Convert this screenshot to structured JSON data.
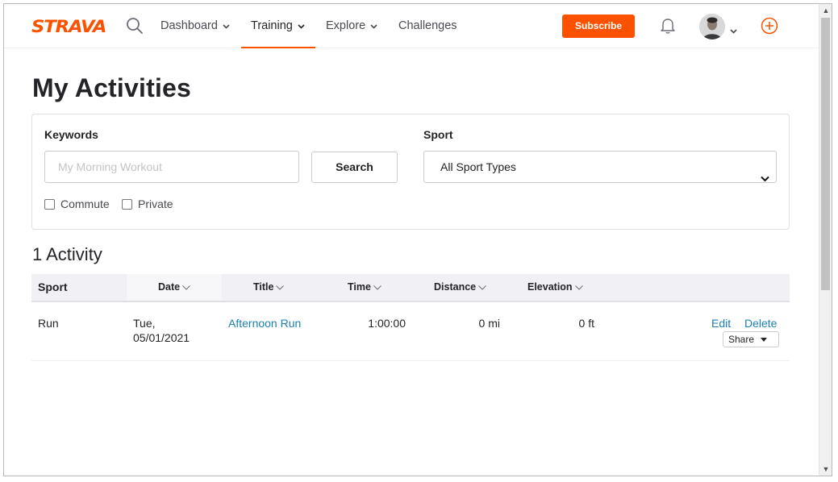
{
  "nav": {
    "logo": "STRAVA",
    "items": [
      {
        "label": "Dashboard",
        "has_menu": true
      },
      {
        "label": "Training",
        "has_menu": true,
        "active": true
      },
      {
        "label": "Explore",
        "has_menu": true
      },
      {
        "label": "Challenges",
        "has_menu": false
      }
    ],
    "subscribe_label": "Subscribe",
    "icons": {
      "search": "search-icon",
      "notifications": "bell-icon",
      "avatar": "avatar",
      "upload": "plus-circle-icon"
    }
  },
  "colors": {
    "brand": "#fc5200",
    "link": "#1c7fb0",
    "text": "#242428",
    "header_bg": "#f0f0f5"
  },
  "page": {
    "title": "My Activities"
  },
  "filters": {
    "keywords_label": "Keywords",
    "keywords_placeholder": "My Morning Workout",
    "keywords_value": "",
    "search_label": "Search",
    "sport_label": "Sport",
    "sport_selected": "All Sport Types",
    "commute_label": "Commute",
    "commute_checked": false,
    "private_label": "Private",
    "private_checked": false
  },
  "results": {
    "count_label": "1 Activity"
  },
  "table": {
    "columns": [
      "Sport",
      "Date",
      "Title",
      "Time",
      "Distance",
      "Elevation"
    ],
    "rows": [
      {
        "sport": "Run",
        "date_line1": "Tue,",
        "date_line2": "05/01/2021",
        "title": "Afternoon Run",
        "time": "1:00:00",
        "distance": "0 mi",
        "elevation": "0 ft",
        "edit_label": "Edit",
        "delete_label": "Delete",
        "share_label": "Share"
      }
    ]
  }
}
